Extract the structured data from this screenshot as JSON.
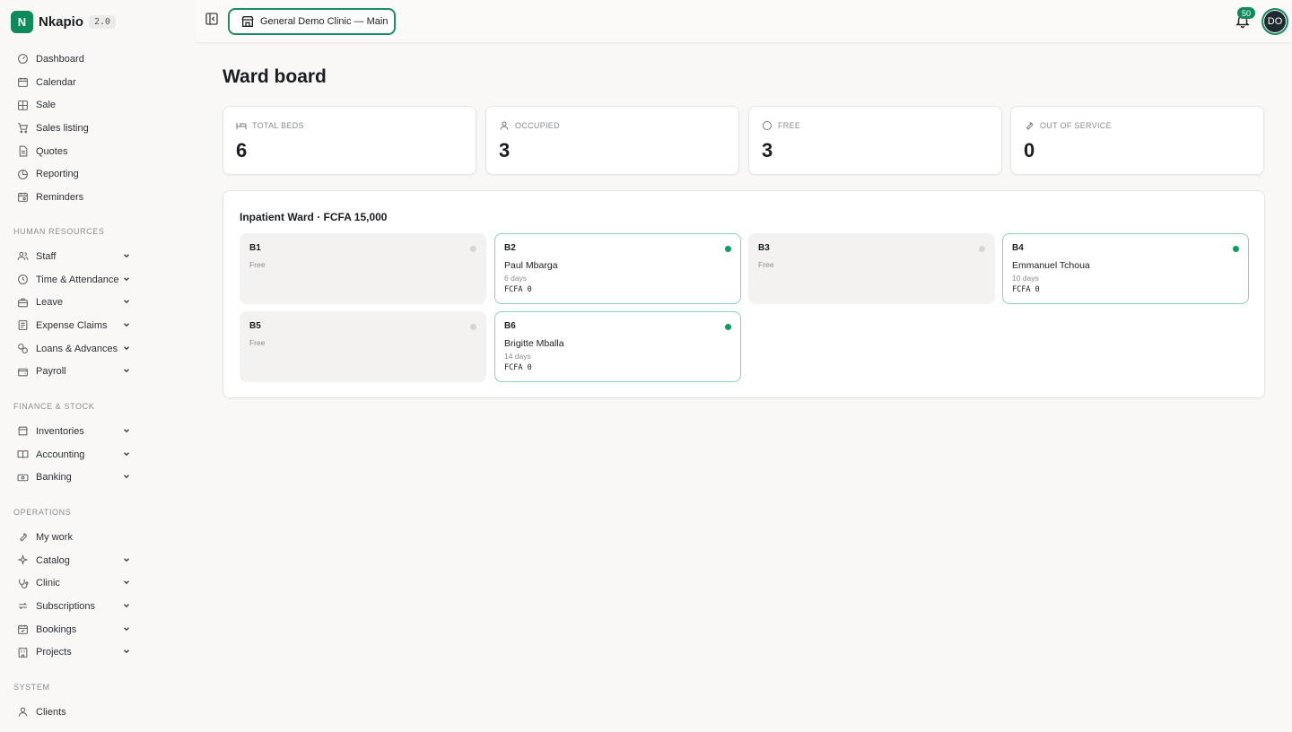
{
  "brand": {
    "logo_letter": "N",
    "name": "Nkapio",
    "version": "2.0",
    "accent": "#0f8a5a"
  },
  "sidebar": {
    "main": [
      {
        "label": "Dashboard",
        "icon": "gauge-icon"
      },
      {
        "label": "Calendar",
        "icon": "calendar-icon"
      },
      {
        "label": "Sale",
        "icon": "grid-icon"
      },
      {
        "label": "Sales listing",
        "icon": "cart-icon"
      },
      {
        "label": "Quotes",
        "icon": "document-icon"
      },
      {
        "label": "Reporting",
        "icon": "chart-icon"
      },
      {
        "label": "Reminders",
        "icon": "calendar-clock-icon"
      }
    ],
    "hr_title": "HUMAN RESOURCES",
    "hr": [
      {
        "label": "Staff",
        "icon": "users-icon"
      },
      {
        "label": "Time & Attendance",
        "icon": "clock-icon"
      },
      {
        "label": "Leave",
        "icon": "briefcase-icon"
      },
      {
        "label": "Expense Claims",
        "icon": "receipt-icon"
      },
      {
        "label": "Loans & Advances",
        "icon": "coins-icon"
      },
      {
        "label": "Payroll",
        "icon": "wallet-icon"
      }
    ],
    "finance_title": "FINANCE & STOCK",
    "finance": [
      {
        "label": "Inventories",
        "icon": "store-icon"
      },
      {
        "label": "Accounting",
        "icon": "book-icon"
      },
      {
        "label": "Banking",
        "icon": "banknote-icon"
      }
    ],
    "ops_title": "OPERATIONS",
    "ops": [
      {
        "label": "My work",
        "icon": "wrench-icon"
      },
      {
        "label": "Catalog",
        "icon": "sparkles-icon"
      },
      {
        "label": "Clinic",
        "icon": "stethoscope-icon"
      },
      {
        "label": "Subscriptions",
        "icon": "repeat-icon"
      },
      {
        "label": "Bookings",
        "icon": "calendar-check-icon"
      },
      {
        "label": "Projects",
        "icon": "building-icon"
      }
    ],
    "system_title": "SYSTEM",
    "system": [
      {
        "label": "Clients",
        "icon": "user-icon"
      }
    ]
  },
  "topbar": {
    "location": "General Demo Clinic — Main",
    "notification_count": "50",
    "avatar_initials": "DO"
  },
  "page": {
    "title": "Ward board"
  },
  "stats": [
    {
      "label": "TOTAL BEDS",
      "value": "6",
      "icon": "bed-icon"
    },
    {
      "label": "OCCUPIED",
      "value": "3",
      "icon": "user-icon"
    },
    {
      "label": "FREE",
      "value": "3",
      "icon": "circle-icon"
    },
    {
      "label": "OUT OF SERVICE",
      "value": "0",
      "icon": "wrench-icon"
    }
  ],
  "ward": {
    "title": "Inpatient Ward · FCFA 15,000",
    "beds": [
      {
        "code": "B1",
        "status": "Free"
      },
      {
        "code": "B2",
        "patient": "Paul Mbarga",
        "days": "6 days",
        "amount": "FCFA 0"
      },
      {
        "code": "B3",
        "status": "Free"
      },
      {
        "code": "B4",
        "patient": "Emmanuel Tchoua",
        "days": "10 days",
        "amount": "FCFA 0"
      },
      {
        "code": "B5",
        "status": "Free"
      },
      {
        "code": "B6",
        "patient": "Brigitte Mballa",
        "days": "14 days",
        "amount": "FCFA 0"
      }
    ]
  }
}
